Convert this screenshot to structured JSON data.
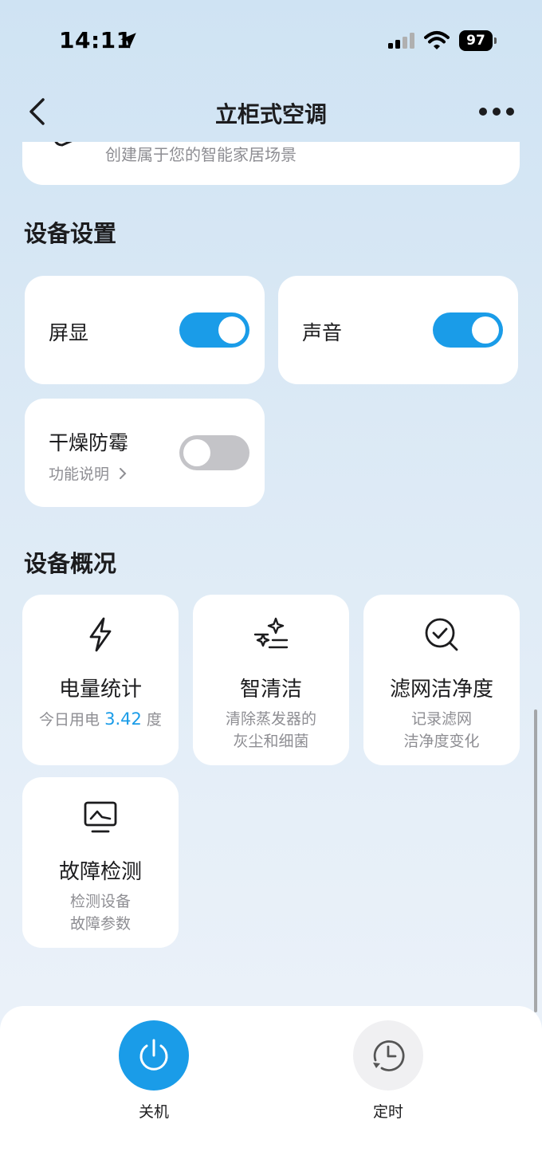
{
  "status": {
    "time": "14:11",
    "battery": "97"
  },
  "nav": {
    "title": "立柜式空调"
  },
  "scene": {
    "subtitle": "创建属于您的智能家居场景"
  },
  "settings": {
    "title": "设备设置",
    "screen_display": {
      "label": "屏显",
      "on": true
    },
    "sound": {
      "label": "声音",
      "on": true
    },
    "dry_mildew": {
      "label": "干燥防霉",
      "sub": "功能说明",
      "on": false
    }
  },
  "overview": {
    "title": "设备概况",
    "power_stats": {
      "title": "电量统计",
      "desc_prefix": "今日用电",
      "value": "3.42",
      "unit": "度",
      "icon": "lightning-icon"
    },
    "smart_clean": {
      "title": "智清洁",
      "desc_line1": "清除蒸发器的",
      "desc_line2": "灰尘和细菌",
      "icon": "sparkle-clean-icon"
    },
    "filter_clean": {
      "title": "滤网洁净度",
      "desc_line1": "记录滤网",
      "desc_line2": "洁净度变化",
      "icon": "magnifier-check-icon"
    },
    "fault_detect": {
      "title": "故障检测",
      "desc_line1": "检测设备",
      "desc_line2": "故障参数",
      "icon": "monitor-icon"
    }
  },
  "bottom": {
    "power_label": "关机",
    "timer_label": "定时"
  },
  "colors": {
    "accent": "#1a9ce8",
    "toggle_off": "#c4c4c8"
  }
}
